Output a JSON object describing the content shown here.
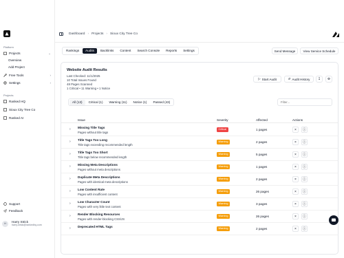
{
  "sidebar": {
    "section_platform": "Platform",
    "projects": "Projects",
    "overview": "Overview",
    "add_project": "Add Project",
    "free_tools": "Free Tools",
    "settings": "Settings",
    "section_projects": "Projects",
    "project_items": [
      "Ranked HQ",
      "Sioux City Tree Co",
      "Ranked AI"
    ],
    "support": "Support",
    "feedback": "Feedback",
    "user_initials": "H",
    "user_name": "Harry Strick",
    "user_email": "harry.strick@rankedhq.com"
  },
  "breadcrumb": [
    "Dashboard",
    "Projects",
    "Sioux City Tree Co"
  ],
  "tabs": [
    "Rankings",
    "Audits",
    "Backlinks",
    "Content",
    "Search Console",
    "Reports",
    "Settings"
  ],
  "active_tab": "Audits",
  "actions": {
    "send_message": "Send Message",
    "view_schedule": "View Service Schedule"
  },
  "audit": {
    "title": "Website Audit Results",
    "last_checked": "Last Checked: 11/1/2025",
    "total_issues": "10 Total Issues Found",
    "pages_scanned": "48 Pages Scanned",
    "summary": "1 Critical • 11 Warning • 1 Notice",
    "start_audit": "Start Audit",
    "audit_history": "Audit History"
  },
  "filters": [
    "All (13)",
    "Critical (1)",
    "Warning (11)",
    "Notice (1)",
    "Passed (43)"
  ],
  "filter_placeholder": "Filter...",
  "table": {
    "headers": [
      "Issue",
      "Severity",
      "Affected",
      "Actions"
    ],
    "rows": [
      {
        "title": "Missing Title Tags",
        "desc": "Pages without title tags",
        "severity": "Critical",
        "affected": "1 pages"
      },
      {
        "title": "Title Tags Too Long",
        "desc": "Title tags exceeding recommended length",
        "severity": "Warning",
        "affected": "2 pages"
      },
      {
        "title": "Title Tags Too Short",
        "desc": "Title tags below recommended length",
        "severity": "Warning",
        "affected": "5 pages"
      },
      {
        "title": "Missing Meta Descriptions",
        "desc": "Pages without meta descriptions",
        "severity": "Warning",
        "affected": "1 pages"
      },
      {
        "title": "Duplicate Meta Descriptions",
        "desc": "Pages with identical meta descriptions",
        "severity": "Warning",
        "affected": "2 pages"
      },
      {
        "title": "Low Content Rate",
        "desc": "Pages with insufficient content",
        "severity": "Warning",
        "affected": "26 pages"
      },
      {
        "title": "Low Character Count",
        "desc": "Pages with very little text content",
        "severity": "Warning",
        "affected": "3 pages"
      },
      {
        "title": "Render Blocking Resources",
        "desc": "Pages with render-blocking CSS/JS",
        "severity": "Warning",
        "affected": "26 pages"
      },
      {
        "title": "Deprecated HTML Tags",
        "desc": "",
        "severity": "Warning",
        "affected": "2 pages"
      }
    ]
  },
  "colors": {
    "critical": "#ef4444",
    "warning": "#f59e0b",
    "dark": "#111827"
  }
}
